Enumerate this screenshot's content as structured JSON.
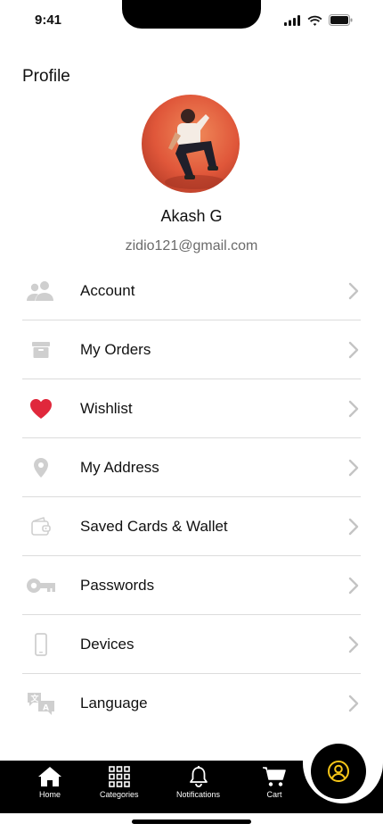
{
  "status_bar": {
    "time": "9:41"
  },
  "header": {
    "title": "Profile"
  },
  "profile": {
    "name": "Akash G",
    "email": "zidio121@gmail.com"
  },
  "menu": {
    "items": [
      {
        "label": "Account",
        "icon": "people-icon"
      },
      {
        "label": "My Orders",
        "icon": "archive-box-icon"
      },
      {
        "label": "Wishlist",
        "icon": "heart-icon"
      },
      {
        "label": "My Address",
        "icon": "location-pin-icon"
      },
      {
        "label": "Saved Cards & Wallet",
        "icon": "wallet-icon"
      },
      {
        "label": "Passwords",
        "icon": "key-icon"
      },
      {
        "label": "Devices",
        "icon": "mobile-device-icon"
      },
      {
        "label": "Language",
        "icon": "translate-icon"
      }
    ]
  },
  "bottom_nav": {
    "items": [
      {
        "label": "Home",
        "icon": "home-icon"
      },
      {
        "label": "Categories",
        "icon": "grid-icon"
      },
      {
        "label": "Notifications",
        "icon": "bell-icon"
      },
      {
        "label": "Cart",
        "icon": "cart-icon"
      }
    ],
    "active": "profile-icon"
  },
  "colors": {
    "accent": "#f5c518",
    "wishlist": "#e0283c",
    "icon_muted": "#c9c9c9",
    "nav_bg": "#000000"
  }
}
